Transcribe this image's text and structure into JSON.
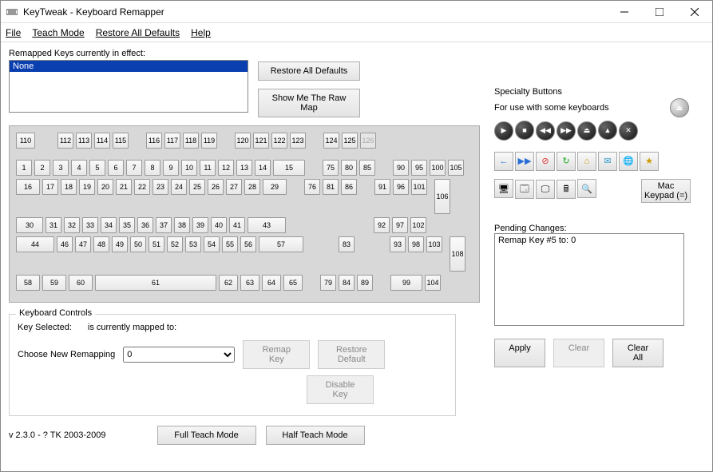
{
  "title": "KeyTweak -  Keyboard Remapper",
  "menu": {
    "file": "File",
    "teach": "Teach Mode",
    "restore": "Restore All Defaults",
    "help": "Help"
  },
  "remapped": {
    "label": "Remapped Keys currently in effect:",
    "items": [
      "None"
    ]
  },
  "buttons": {
    "restore_all": "Restore All Defaults",
    "show_raw": "Show Me The Raw Map",
    "remap": "Remap Key",
    "restore_default": "Restore Default",
    "disable": "Disable Key",
    "full_teach": "Full Teach Mode",
    "half_teach": "Half Teach Mode",
    "apply": "Apply",
    "clear": "Clear",
    "clear_all": "Clear All",
    "mac_keypad": "Mac Keypad (=)"
  },
  "specialty": {
    "title": "Specialty Buttons",
    "sub": "For use with some keyboards"
  },
  "controls": {
    "title": "Keyboard Controls",
    "key_selected": "Key Selected:",
    "mapped_to": "is currently mapped to:",
    "choose": "Choose New Remapping",
    "dropdown_value": "0"
  },
  "pending": {
    "title": "Pending Changes:",
    "items": [
      "Remap Key #5 to:  0"
    ]
  },
  "version": "v 2.3.0 - ? TK 2003-2009",
  "kb": {
    "r0a": [
      "110"
    ],
    "r0b": [
      "112",
      "113",
      "114",
      "115"
    ],
    "r0c": [
      "116",
      "117",
      "118",
      "119"
    ],
    "r0d": [
      "120",
      "121",
      "122",
      "123"
    ],
    "r0e": [
      "124",
      "125",
      "126"
    ],
    "r1main": [
      "1",
      "2",
      "3",
      "4",
      "5",
      "6",
      "7",
      "8",
      "9",
      "10",
      "11",
      "12",
      "13",
      "14",
      "15"
    ],
    "r1nav": [
      "75",
      "80",
      "85"
    ],
    "r1num": [
      "90",
      "95",
      "100",
      "105"
    ],
    "r2main": [
      "16",
      "17",
      "18",
      "19",
      "20",
      "21",
      "22",
      "23",
      "24",
      "25",
      "26",
      "27",
      "28",
      "29"
    ],
    "r2nav": [
      "76",
      "81",
      "86"
    ],
    "r2num": [
      "91",
      "96",
      "101"
    ],
    "r3main": [
      "30",
      "31",
      "32",
      "33",
      "34",
      "35",
      "36",
      "37",
      "38",
      "39",
      "40",
      "41",
      "43"
    ],
    "r3num": [
      "92",
      "97",
      "102"
    ],
    "r4main": [
      "44",
      "46",
      "47",
      "48",
      "49",
      "50",
      "51",
      "52",
      "53",
      "54",
      "55",
      "56",
      "57"
    ],
    "r4nav": [
      "83"
    ],
    "r4num": [
      "93",
      "98",
      "103"
    ],
    "r5main": [
      "58",
      "59",
      "60",
      "61",
      "62",
      "63",
      "64",
      "65"
    ],
    "r5nav": [
      "79",
      "84",
      "89"
    ],
    "r5num": [
      "99",
      "104"
    ],
    "numtall": [
      "106",
      "108"
    ]
  },
  "icons": {
    "spec_round": [
      "play",
      "stop",
      "rewind",
      "forward",
      "eject",
      "volup",
      "mute"
    ],
    "spec_sq1": [
      "back",
      "forward",
      "stop-red",
      "refresh",
      "home",
      "mail",
      "globe",
      "star"
    ],
    "spec_sq2": [
      "computer",
      "desktop",
      "monitor",
      "calculator",
      "search"
    ]
  }
}
